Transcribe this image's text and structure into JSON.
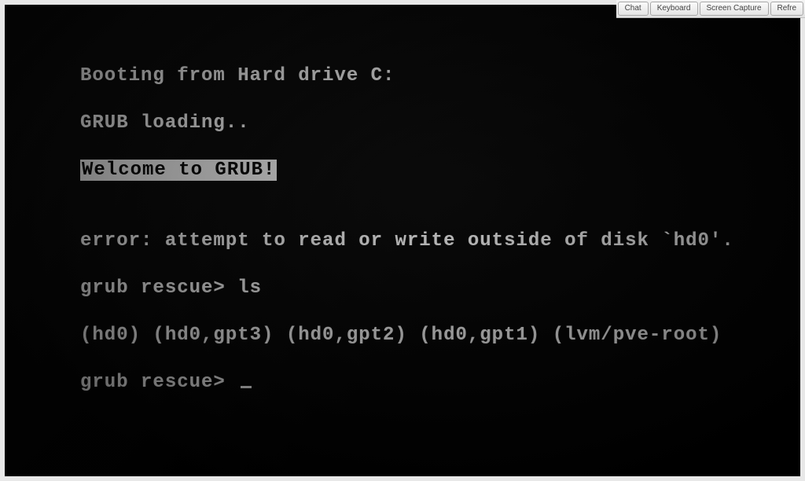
{
  "toolbar": {
    "buttons": {
      "chat": "Chat",
      "keyboard": "Keyboard",
      "screen_capture": "Screen Capture",
      "refresh": "Refre"
    }
  },
  "terminal": {
    "line1": "Booting from Hard drive C:",
    "line2": "GRUB loading..",
    "line3_inverted": "Welcome to GRUB!",
    "blank1": "",
    "line4": "error: attempt to read or write outside of disk `hd0'.",
    "line5_prompt": "grub rescue> ",
    "line5_cmd": "ls",
    "line6": "(hd0) (hd0,gpt3) (hd0,gpt2) (hd0,gpt1) (lvm/pve-root)",
    "line7_prompt": "grub rescue> "
  }
}
